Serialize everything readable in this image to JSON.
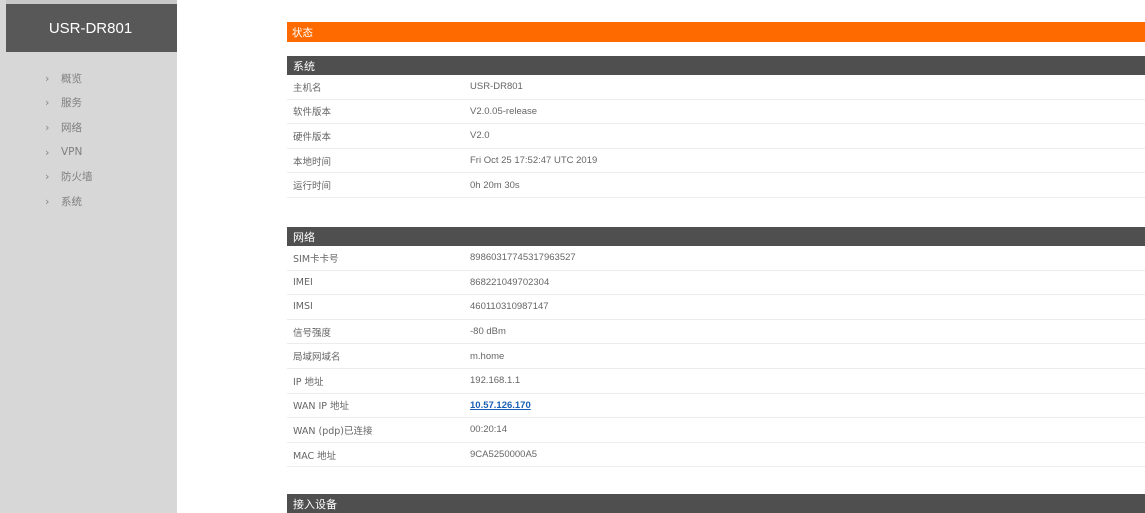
{
  "sidebar": {
    "title": "USR-DR801",
    "items": [
      {
        "label": "概览"
      },
      {
        "label": "服务"
      },
      {
        "label": "网络"
      },
      {
        "label": "VPN"
      },
      {
        "label": "防火墙"
      },
      {
        "label": "系统"
      }
    ]
  },
  "main": {
    "banner": "状态",
    "system": {
      "title": "系统",
      "rows": [
        {
          "key": "主机名",
          "value": "USR-DR801"
        },
        {
          "key": "软件版本",
          "value": "V2.0.05-release"
        },
        {
          "key": "硬件版本",
          "value": "V2.0"
        },
        {
          "key": "本地时间",
          "value": "Fri Oct 25 17:52:47 UTC 2019"
        },
        {
          "key": "运行时间",
          "value": "0h 20m 30s"
        }
      ]
    },
    "network": {
      "title": "网络",
      "rows": [
        {
          "key": "SIM卡卡号",
          "value": "89860317745317963527"
        },
        {
          "key": "IMEI",
          "value": "868221049702304"
        },
        {
          "key": "IMSI",
          "value": "460110310987147"
        },
        {
          "key": "信号强度",
          "value": "-80 dBm"
        },
        {
          "key": "局域网域名",
          "value": "m.home"
        },
        {
          "key": "IP 地址",
          "value": "192.168.1.1"
        },
        {
          "key": "WAN IP 地址",
          "value": "10.57.126.170"
        },
        {
          "key": "WAN (pdp)已连接",
          "value": "00:20:14"
        },
        {
          "key": "MAC 地址",
          "value": "9CA5250000A5"
        }
      ]
    },
    "devices": {
      "title": "接入设备"
    }
  },
  "colors": {
    "accent": "#ff6a00",
    "header": "#4f4f4f",
    "sidebar": "#d7d7d7",
    "brand": "#585858",
    "link": "#1a5fb4"
  },
  "icons": {
    "nav_chevron": "chevron-right-icon"
  }
}
